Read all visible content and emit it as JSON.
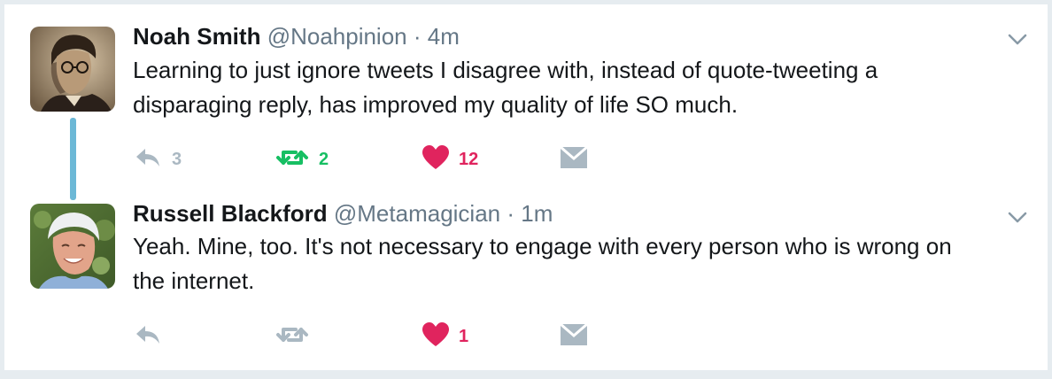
{
  "tweets": [
    {
      "name": "Noah Smith",
      "handle": "@Noahpinion",
      "separator": "·",
      "time": "4m",
      "text": "Learning to just ignore tweets I disagree with, instead of quote-tweeting a disparaging reply, has improved my quality of life SO much.",
      "reply_count": "3",
      "retweet_count": "2",
      "like_count": "12",
      "retweeted": true,
      "liked": true,
      "avatar": "sepia-portrait-man-with-glasses"
    },
    {
      "name": "Russell Blackford",
      "handle": "@Metamagician",
      "separator": "·",
      "time": "1m",
      "text": "Yeah. Mine, too. It's not necessary to engage with every person who is wrong on the internet.",
      "reply_count": "",
      "retweet_count": "",
      "like_count": "1",
      "retweeted": false,
      "liked": true,
      "avatar": "smiling-man-white-hair"
    }
  ],
  "colors": {
    "reply_icon": "#aab8c2",
    "retweet_active": "#17bf63",
    "retweet_inactive": "#aab8c2",
    "like": "#e0245e",
    "thread_line": "#6cb8d6",
    "border": "#e6ecf0"
  },
  "icons": [
    "reply-icon",
    "retweet-icon",
    "heart-icon",
    "envelope-icon",
    "chevron-down-icon"
  ]
}
